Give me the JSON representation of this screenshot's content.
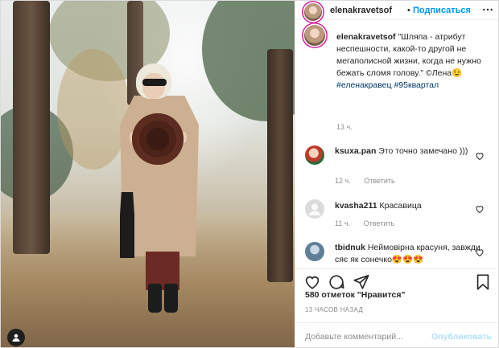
{
  "post": {
    "photo_alt": "",
    "watermark_icon": "person-icon"
  },
  "header": {
    "username": "elenakravetsof",
    "separator": "•",
    "follow_label": "Подписаться",
    "more_icon": "more-icon"
  },
  "caption": {
    "username": "elenakravetsof",
    "text": "\"Шляпа - атрибут неспешности, какой-то другой не мегаполисной жизни, когда не нужно бежать сломя голову.\" ©Лена😉",
    "hashtags": [
      "#еленакравец",
      "#95квартал"
    ],
    "time": "13 ч."
  },
  "comments": [
    {
      "username": "ksuxa.pan",
      "text": "Это точно замечано )))",
      "time": "12 ч.",
      "reply": "Ответить"
    },
    {
      "username": "kvasha211",
      "text": "Красавица",
      "time": "11 ч.",
      "reply": "Ответить"
    },
    {
      "username": "tbidnuk",
      "text": "Неймовірна красуня, завжди сяє як сонечко😍😍😍",
      "time": "",
      "reply": ""
    }
  ],
  "actions": {
    "like_icon": "heart-icon",
    "comment_icon": "comment-icon",
    "share_icon": "share-icon",
    "save_icon": "bookmark-icon"
  },
  "likes": "580 отметок \"Нравится\"",
  "posted_ago": "13 ЧАСОВ НАЗАД",
  "composer": {
    "placeholder": "Добавьте комментарий...",
    "publish_label": "Опубликовать"
  },
  "colors": {
    "accent": "#0095f6",
    "publish_disabled": "#b2dffc",
    "hashtag": "#00376b",
    "muted": "#8e8e8e"
  }
}
